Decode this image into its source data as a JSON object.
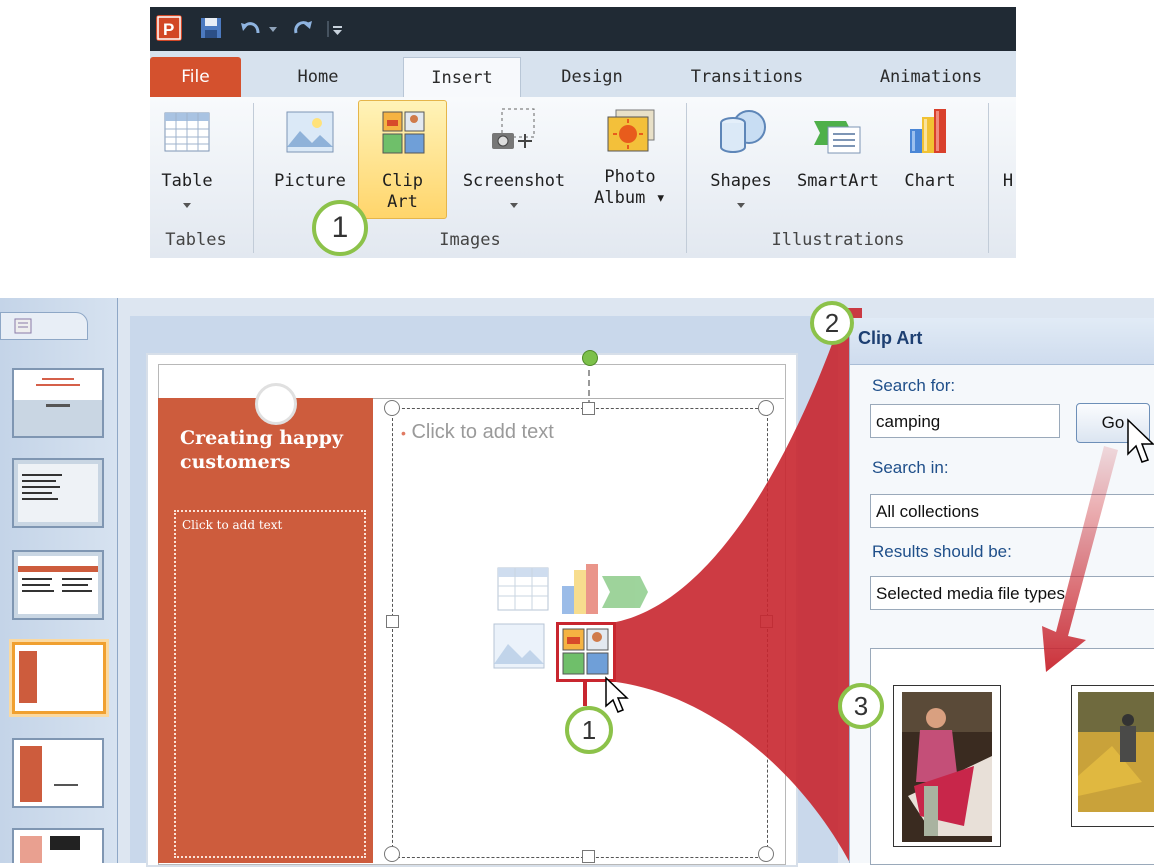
{
  "ribbon": {
    "tabs": [
      {
        "label": "File"
      },
      {
        "label": "Home"
      },
      {
        "label": "Insert"
      },
      {
        "label": "Design"
      },
      {
        "label": "Transitions"
      },
      {
        "label": "Animations"
      }
    ],
    "buttons": {
      "table": "Table",
      "picture": "Picture",
      "clipart_line1": "Clip",
      "clipart_line2": "Art",
      "screenshot": "Screenshot",
      "photo_line1": "Photo",
      "photo_line2": "Album ▾",
      "shapes": "Shapes",
      "smartart": "SmartArt",
      "chart": "Chart",
      "cut_off": "H"
    },
    "groups": {
      "tables": "Tables",
      "images": "Images",
      "illustrations": "Illustrations"
    }
  },
  "callouts": {
    "one": "1",
    "two": "2",
    "three": "3",
    "one_b": "1"
  },
  "slide": {
    "title": "Creating happy customers",
    "left_placeholder": "Click to add text",
    "content_placeholder": "Click to add text"
  },
  "clip_art_pane": {
    "title": "Clip Art",
    "search_for_label": "Search for:",
    "search_value": "camping",
    "go_button": "Go",
    "search_in_label": "Search in:",
    "search_in_value": "All collections",
    "results_label": "Results should be:",
    "results_value": "Selected media file types"
  },
  "colors": {
    "accent_red": "#c8262f",
    "callout_green": "#8cc24a",
    "file_tab": "#d4512e",
    "slide_panel": "#cd5c3d"
  }
}
